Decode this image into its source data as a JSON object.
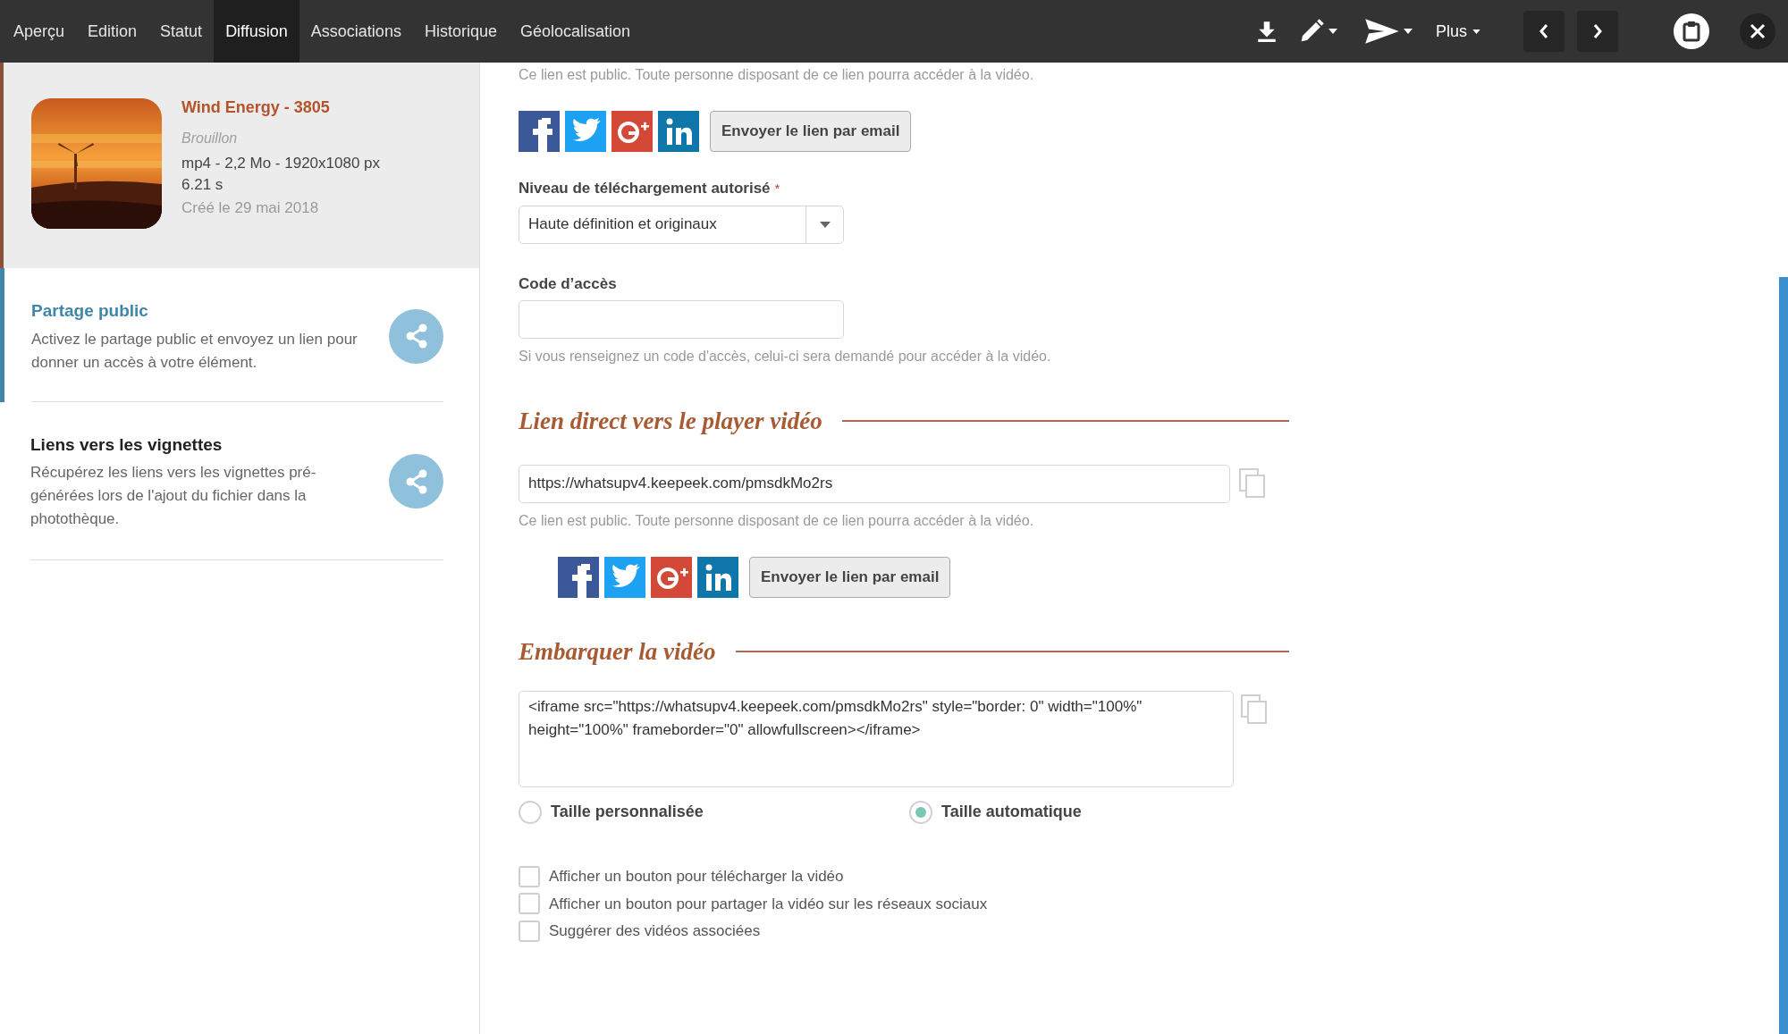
{
  "toolbar": {
    "tabs": [
      {
        "label": "Aperçu",
        "selected": false
      },
      {
        "label": "Edition",
        "selected": false
      },
      {
        "label": "Statut",
        "selected": false
      },
      {
        "label": "Diffusion",
        "selected": true
      },
      {
        "label": "Associations",
        "selected": false
      },
      {
        "label": "Historique",
        "selected": false
      },
      {
        "label": "Géolocalisation",
        "selected": false
      }
    ],
    "more_label": "Plus"
  },
  "asset": {
    "title": "Wind Energy - 3805",
    "status": "Brouillon",
    "info": "mp4 - 2,2 Mo - 1920x1080 px",
    "duration": "6.21 s",
    "created": "Créé le 29 mai 2018"
  },
  "sidebar": {
    "items": [
      {
        "title": "Partage public",
        "description": "Activez le partage public et envoyez un lien pour donner un accès à votre élément.",
        "selected": true
      },
      {
        "title": "Liens vers les vignettes",
        "description": "Récupérez les liens vers les vignettes pré-générées lors de l'ajout du fichier dans la photothèque.",
        "selected": false
      }
    ]
  },
  "public_link": {
    "note": "Ce lien est public. Toute personne disposant de ce lien pourra accéder à la vidéo.",
    "email_label": "Envoyer le lien par email"
  },
  "download_level": {
    "label": "Niveau de téléchargement autorisé",
    "required_mark": "*",
    "value": "Haute définition et originaux"
  },
  "access_code": {
    "label": "Code d’accès",
    "hint": "Si vous renseignez un code d'accès, celui-ci sera demandé pour accéder à la vidéo."
  },
  "direct_link": {
    "heading": "Lien direct vers le player vidéo",
    "url": "https://whatsupv4.keepeek.com/pmsdkMo2rs",
    "note": "Ce lien est public. Toute personne disposant de ce lien pourra accéder à la vidéo.",
    "email_label": "Envoyer le lien par email"
  },
  "embed": {
    "heading": "Embarquer la vidéo",
    "code": "<iframe src=\"https://whatsupv4.keepeek.com/pmsdkMo2rs\" style=\"border: 0\" width=\"100%\" height=\"100%\" frameborder=\"0\" allowfullscreen></iframe>",
    "size_options": [
      {
        "label": "Taille personnalisée",
        "selected": false
      },
      {
        "label": "Taille automatique",
        "selected": true
      }
    ],
    "checkboxes": [
      {
        "label": "Afficher un bouton pour télécharger la vidéo",
        "checked": false
      },
      {
        "label": "Afficher un bouton pour partager la vidéo sur les réseaux sociaux",
        "checked": false
      },
      {
        "label": "Suggérer des vidéos associées",
        "checked": false
      }
    ]
  }
}
